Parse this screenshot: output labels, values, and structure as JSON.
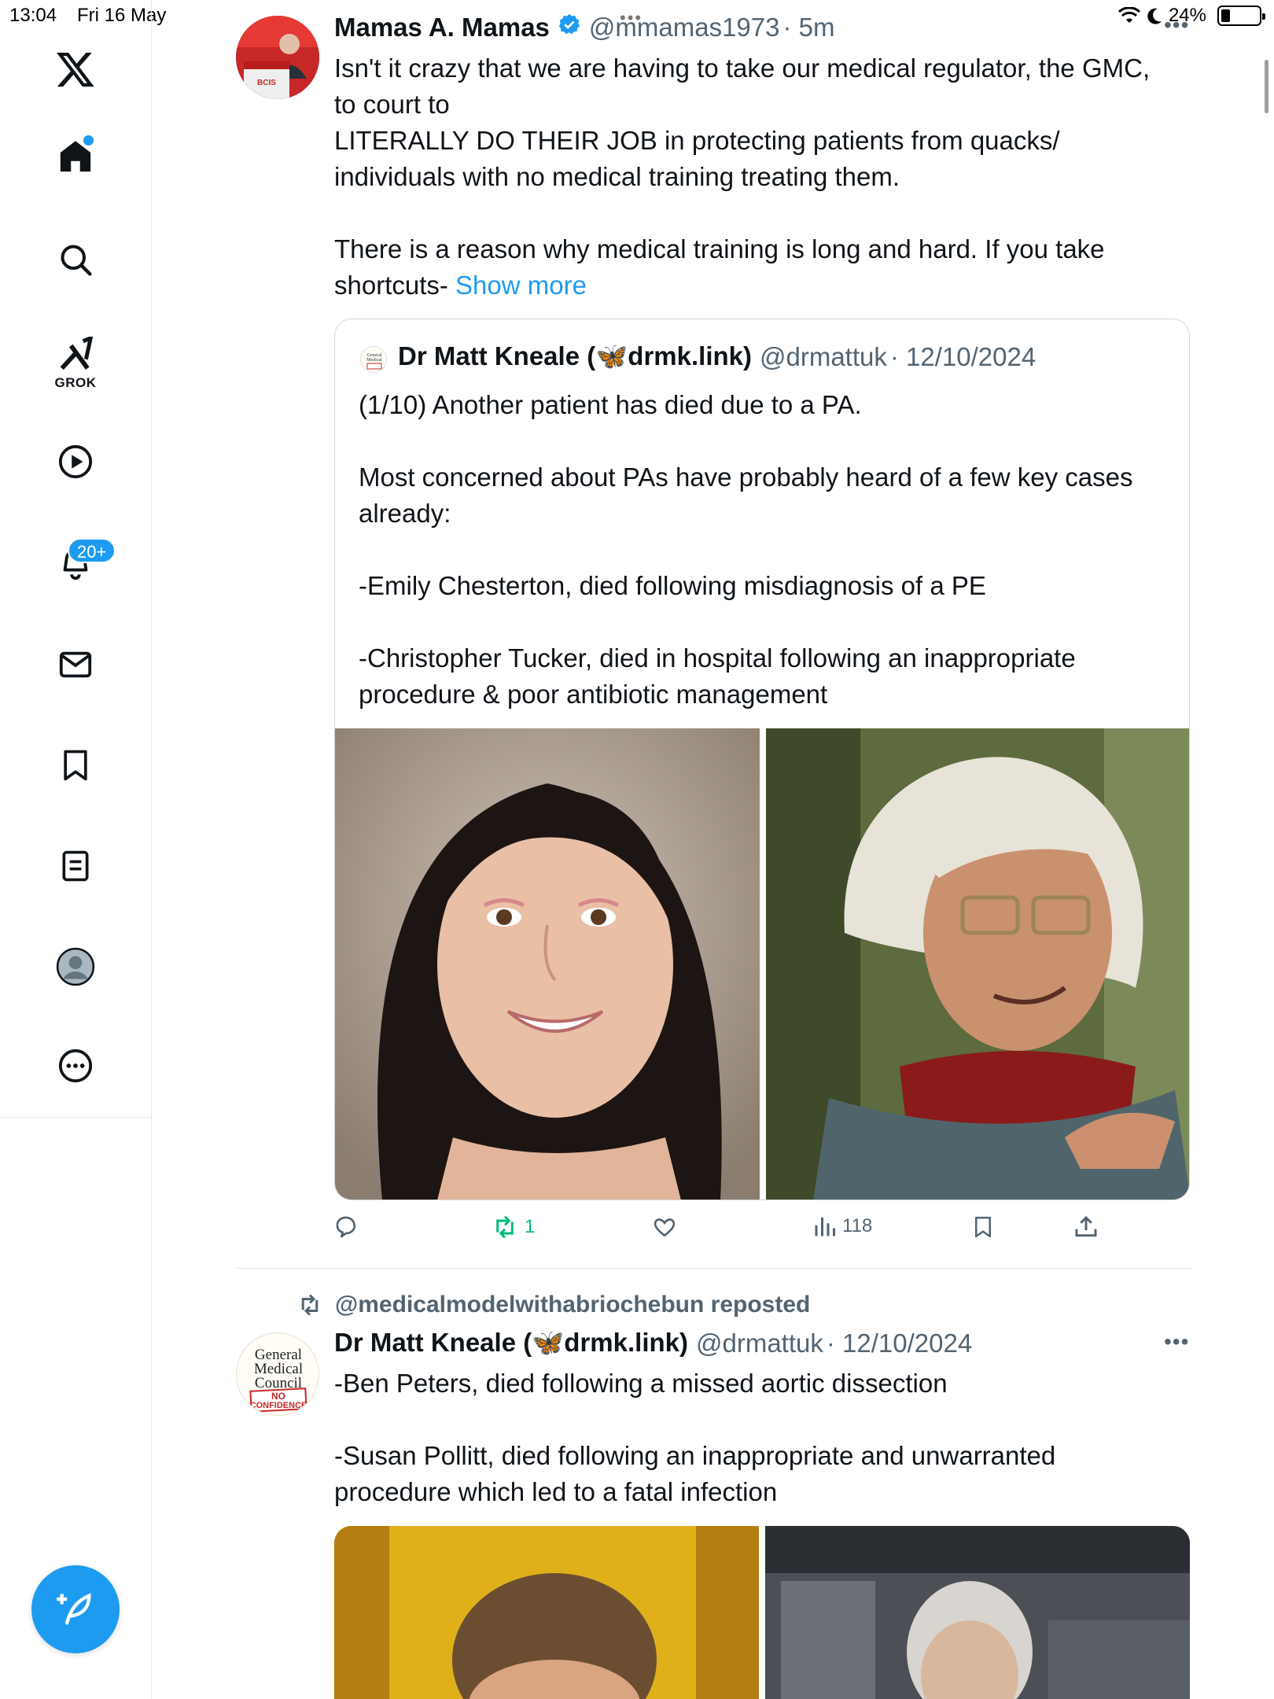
{
  "status_bar": {
    "time": "13:04",
    "date": "Fri 16 May",
    "battery": "24%",
    "battery_level": 0.24
  },
  "sidebar": {
    "items": [
      {
        "name": "x-logo",
        "label": ""
      },
      {
        "name": "home",
        "label": ""
      },
      {
        "name": "explore",
        "label": ""
      },
      {
        "name": "grok",
        "label": "GROK"
      },
      {
        "name": "videos",
        "label": ""
      },
      {
        "name": "notifications",
        "label": ""
      },
      {
        "name": "messages",
        "label": ""
      },
      {
        "name": "bookmarks",
        "label": ""
      },
      {
        "name": "lists",
        "label": ""
      },
      {
        "name": "profile",
        "label": ""
      },
      {
        "name": "more",
        "label": ""
      }
    ],
    "notification_badge": "20+"
  },
  "tweet1": {
    "author_name": "Mamas A. Mamas",
    "handle": "@mmamas1973",
    "time": "· 5m",
    "text": "Isn't it crazy that we are having to take our medical regulator, the GMC,\nto court to\nLITERALLY DO THEIR JOB in protecting patients from quacks/\nindividuals with no medical training treating them.\n\nThere is a reason why medical training is long and hard. If you take\nshortcuts- ",
    "show_more": "Show more",
    "avatar_podium_text": "BCIS",
    "quote": {
      "author_name": "Dr Matt Kneale (🦋drmk.link)",
      "handle": "@drmattuk",
      "time": "· 12/10/2024",
      "text": "(1/10) Another patient has died due to a PA.\n\nMost concerned about PAs have probably heard of a few key cases\nalready:\n\n-Emily Chesterton, died following misdiagnosis of a PE\n\n-Christopher Tucker, died in hospital following an inappropriate\nprocedure & poor antibiotic management"
    },
    "actions": {
      "retweets": "1",
      "views": "118"
    }
  },
  "tweet2": {
    "reposted_by": "@medicalmodelwithabriochebun reposted",
    "author_name": "Dr Matt Kneale (🦋drmk.link)",
    "handle": "@drmattuk",
    "time": "· 12/10/2024",
    "text": "-Ben Peters, died following a missed aortic dissection\n\n-Susan Pollitt, died following an inappropriate and unwarranted\nprocedure which led to a fatal infection",
    "avatar": {
      "line1": "General",
      "line2": "Medical",
      "line3": "Council",
      "stamp1": "NO",
      "stamp2": "CONFIDENCE"
    }
  },
  "colors": {
    "accent": "#1d9bf0",
    "retweet_green": "#00ba7c",
    "secondary_text": "#536471",
    "border": "#cfd9de"
  }
}
